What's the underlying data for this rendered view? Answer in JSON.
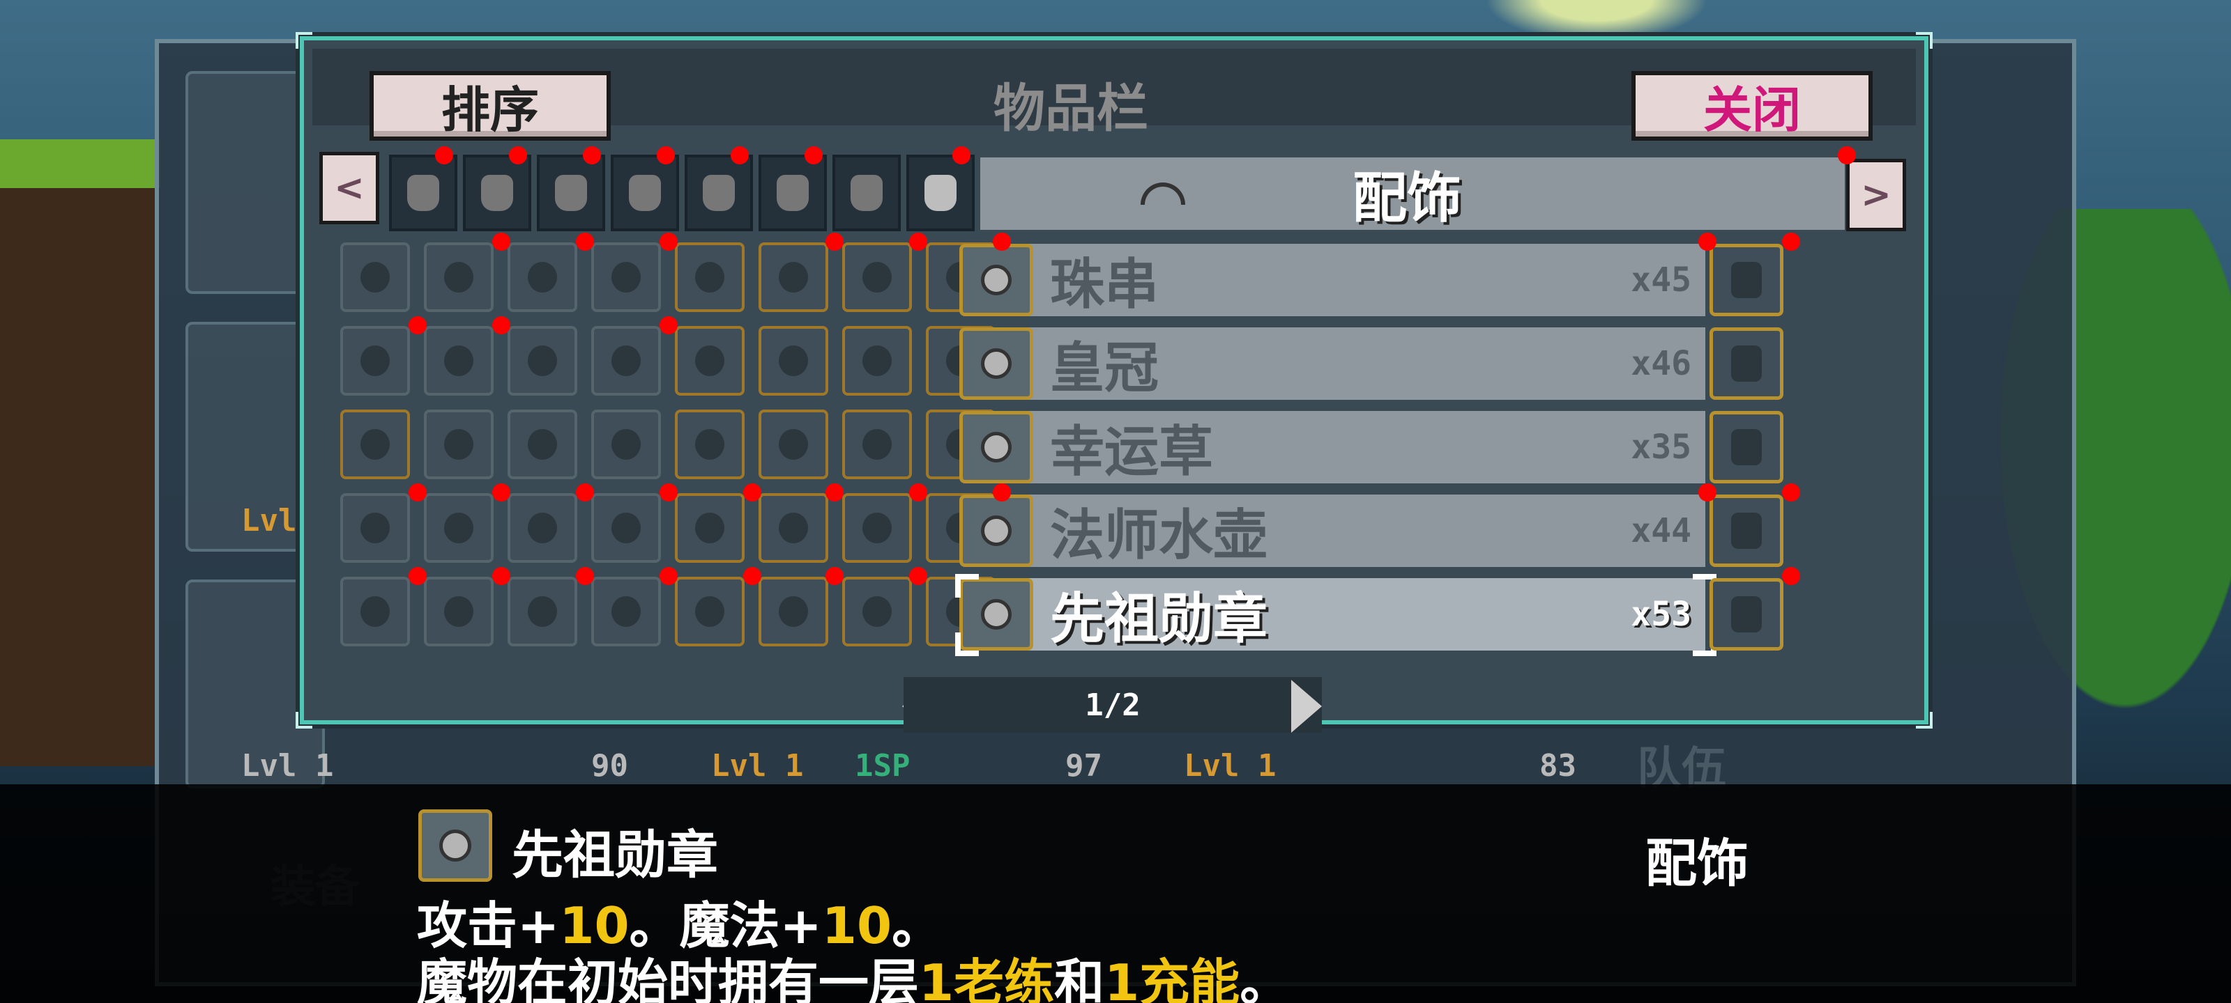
{
  "inventory": {
    "title": "物品栏",
    "sort_label": "排序",
    "close_label": "关闭",
    "nav_prev": "<",
    "nav_next": ">",
    "category_tabs": [
      "drop-icon",
      "axe-icon",
      "fruit-icon",
      "bottle-icon",
      "hammer-icon",
      "sparkle-icon",
      "key-icon",
      "sword-icon"
    ],
    "selected_category": "配饰",
    "items": [
      {
        "name": "珠串",
        "count": "x45"
      },
      {
        "name": "皇冠",
        "count": "x46"
      },
      {
        "name": "幸运草",
        "count": "x35"
      },
      {
        "name": "法师水壶",
        "count": "x44"
      },
      {
        "name": "先祖勋章",
        "count": "x53"
      }
    ],
    "selected_index": 4,
    "page": "1/2"
  },
  "party": {
    "levels": [
      "Lvl",
      "Lvl 1",
      "Lvl 1",
      "Lvl 1"
    ],
    "sp": "1SP",
    "stats": [
      "90",
      "97",
      "83"
    ],
    "faint_labels": [
      "装备",
      "队伍"
    ]
  },
  "description": {
    "item_name": "先祖勋章",
    "item_type": "配饰",
    "line1": {
      "p1": "攻击+",
      "v1": "10",
      "p2": "。魔法+",
      "v2": "10",
      "p3": "。"
    },
    "line2": {
      "p1": "魔物在初始时拥有一层",
      "h1": "1老练",
      "p2": "和",
      "h2": "1充能",
      "p3": "。"
    }
  },
  "colors": {
    "frame_accent": "#4dc6b4",
    "close_text": "#d0177a",
    "highlight_yellow": "#f2c511",
    "marker_red": "#ff0000"
  }
}
